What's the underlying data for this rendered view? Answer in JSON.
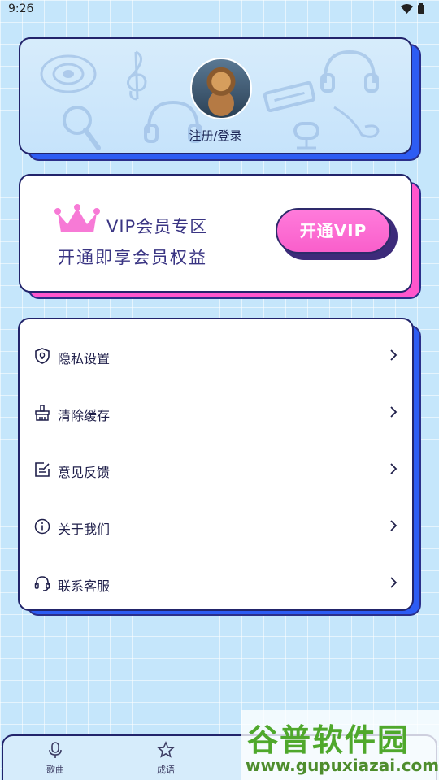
{
  "status_bar": {
    "time": "9:26"
  },
  "profile": {
    "login_text": "注册/登录"
  },
  "vip": {
    "title": "VIP会员专区",
    "subtitle": "开通即享会员权益",
    "button_label": "开通VIP"
  },
  "menu": {
    "items": [
      {
        "label": "隐私设置",
        "icon": "shield-icon"
      },
      {
        "label": "清除缓存",
        "icon": "broom-icon"
      },
      {
        "label": "意见反馈",
        "icon": "edit-icon"
      },
      {
        "label": "关于我们",
        "icon": "info-icon"
      },
      {
        "label": "联系客服",
        "icon": "headset-icon"
      }
    ]
  },
  "bottom_nav": {
    "items": [
      {
        "label": "歌曲",
        "icon": "microphone-icon"
      },
      {
        "label": "成语",
        "icon": "star-icon"
      }
    ]
  },
  "watermark": {
    "title": "谷普软件园",
    "url": "www.gupuxiazai.com"
  }
}
